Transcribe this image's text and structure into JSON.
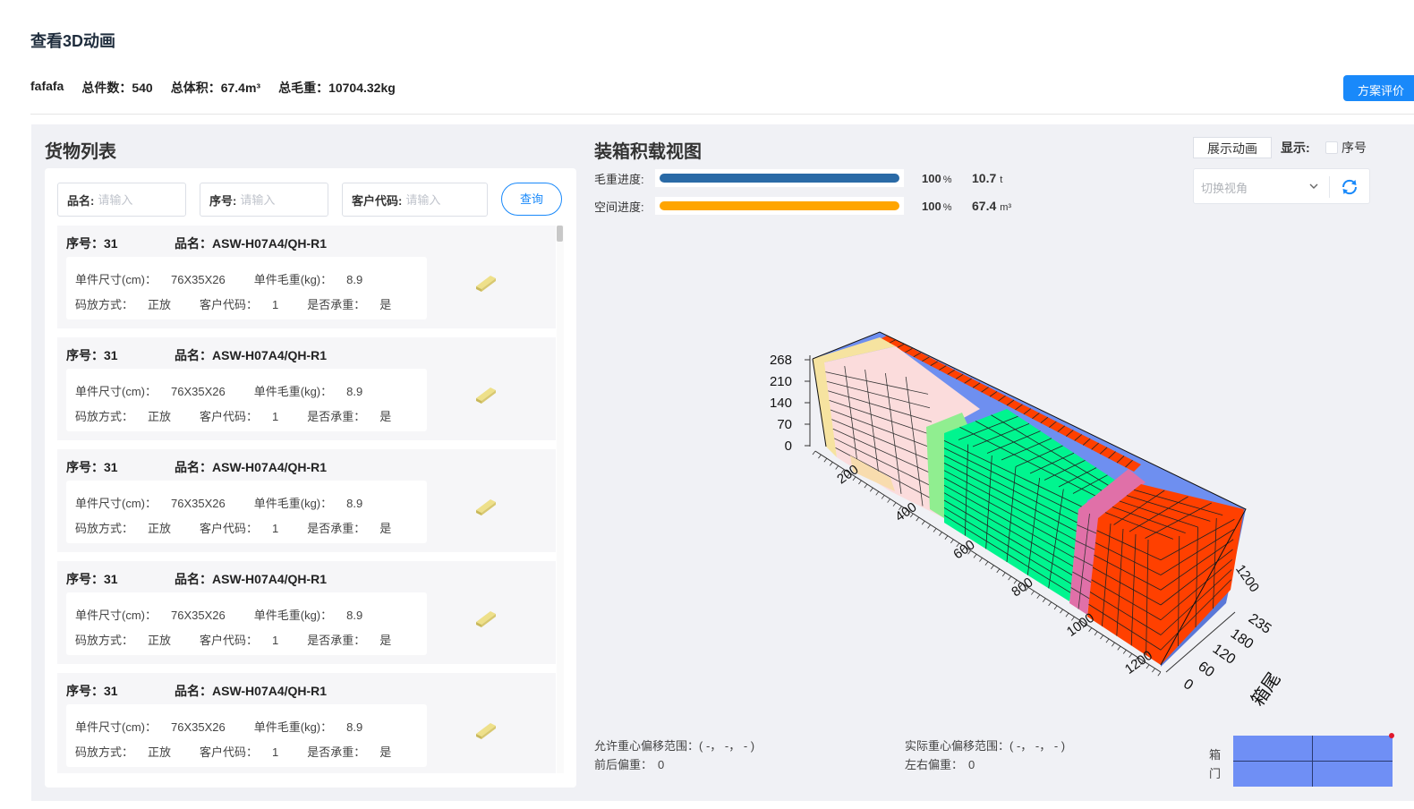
{
  "page": {
    "title": "查看3D动画"
  },
  "summary": {
    "plan_name": "fafafa",
    "total_count_label": "总件数：",
    "total_count": "540",
    "total_volume_label": "总体积：",
    "total_volume": "67.4m³",
    "total_weight_label": "总毛重：",
    "total_weight": "10704.32kg"
  },
  "eval_button": "方案评价",
  "goods": {
    "title": "货物列表",
    "search": {
      "name_label": "品名:",
      "name_placeholder": "请输入",
      "seq_label": "序号:",
      "seq_placeholder": "请输入",
      "customer_label": "客户代码:",
      "customer_placeholder": "请输入",
      "query_label": "查询"
    },
    "items": [
      {
        "seq_label": "序号：",
        "seq": "31",
        "name_label": "品名：",
        "name": "ASW-H07A4/QH-R1",
        "size_label": "单件尺寸(cm)：",
        "size": "76X35X26",
        "weight_label": "单件毛重(kg)：",
        "weight": "8.9",
        "stack_label": "码放方式：",
        "stack": "正放",
        "customer_label": "客户代码：",
        "customer": "1",
        "bearing_label": "是否承重：",
        "bearing": "是"
      },
      {
        "seq_label": "序号：",
        "seq": "31",
        "name_label": "品名：",
        "name": "ASW-H07A4/QH-R1",
        "size_label": "单件尺寸(cm)：",
        "size": "76X35X26",
        "weight_label": "单件毛重(kg)：",
        "weight": "8.9",
        "stack_label": "码放方式：",
        "stack": "正放",
        "customer_label": "客户代码：",
        "customer": "1",
        "bearing_label": "是否承重：",
        "bearing": "是"
      },
      {
        "seq_label": "序号：",
        "seq": "31",
        "name_label": "品名：",
        "name": "ASW-H07A4/QH-R1",
        "size_label": "单件尺寸(cm)：",
        "size": "76X35X26",
        "weight_label": "单件毛重(kg)：",
        "weight": "8.9",
        "stack_label": "码放方式：",
        "stack": "正放",
        "customer_label": "客户代码：",
        "customer": "1",
        "bearing_label": "是否承重：",
        "bearing": "是"
      },
      {
        "seq_label": "序号：",
        "seq": "31",
        "name_label": "品名：",
        "name": "ASW-H07A4/QH-R1",
        "size_label": "单件尺寸(cm)：",
        "size": "76X35X26",
        "weight_label": "单件毛重(kg)：",
        "weight": "8.9",
        "stack_label": "码放方式：",
        "stack": "正放",
        "customer_label": "客户代码：",
        "customer": "1",
        "bearing_label": "是否承重：",
        "bearing": "是"
      },
      {
        "seq_label": "序号：",
        "seq": "31",
        "name_label": "品名：",
        "name": "ASW-H07A4/QH-R1",
        "size_label": "单件尺寸(cm)：",
        "size": "76X35X26",
        "weight_label": "单件毛重(kg)：",
        "weight": "8.9",
        "stack_label": "码放方式：",
        "stack": "正放",
        "customer_label": "客户代码：",
        "customer": "1",
        "bearing_label": "是否承重：",
        "bearing": "是"
      }
    ]
  },
  "view": {
    "title": "装箱积载视图",
    "weight_progress": {
      "label": "毛重进度:",
      "percent": 100,
      "percent_text": "100",
      "percent_unit": "%",
      "value": "10.7",
      "unit": "t",
      "color": "#2a6aa6"
    },
    "space_progress": {
      "label": "空间进度:",
      "percent": 100,
      "percent_text": "100",
      "percent_unit": "%",
      "value": "67.4",
      "unit": "m³",
      "color": "#ffa500"
    },
    "show_animation": "展示动画",
    "display_label": "显示:",
    "seq_checkbox_label": "序号",
    "switch_view_placeholder": "切换视角",
    "allowed_cg_label": "允许重心偏移范围：",
    "allowed_cg_value": "( -， -， - )",
    "actual_cg_label": "实际重心偏移范围：",
    "actual_cg_value": "( -， -， - )",
    "front_back_label": "前后偏重：",
    "front_back_value": "0",
    "left_right_label": "左右偏重：",
    "left_right_value": "0",
    "door_label_1": "箱",
    "door_label_2": "门"
  },
  "chart_data": {
    "type": "3d-box",
    "z_ticks": [
      "268",
      "210",
      "140",
      "70",
      "0"
    ],
    "x_ticks": [
      "200",
      "400",
      "600",
      "800",
      "1000",
      "1200"
    ],
    "y_ticks": [
      "0",
      "60",
      "120",
      "180",
      "235"
    ],
    "y_label": "箱尾",
    "y_end_label": "1200",
    "colors": {
      "container": "#6e8ff0",
      "beige": "#f6e3a0",
      "pink": "#fbdcdc",
      "light_green": "#90ee90",
      "green": "#00f58f",
      "magenta": "#e070a8",
      "red": "#ff4000"
    }
  }
}
